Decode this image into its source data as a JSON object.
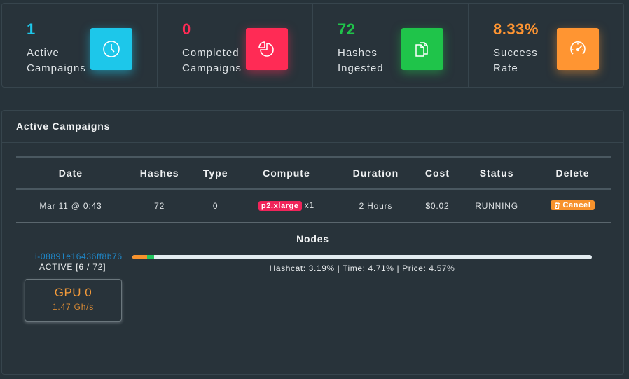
{
  "stats": [
    {
      "value": "1",
      "label": "Active Campaigns",
      "icon": "clock-icon",
      "color": "#1dc7ea",
      "glow": "rgba(29,199,234,0.55)"
    },
    {
      "value": "0",
      "label": "Completed Campaigns",
      "icon": "pie-chart-icon",
      "color": "#ff2b55",
      "glow": "rgba(255,43,85,0.5)"
    },
    {
      "value": "72",
      "label": "Hashes Ingested",
      "icon": "files-icon",
      "color": "#1fc44a",
      "glow": "rgba(31,196,74,0.5)"
    },
    {
      "value": "8.33%",
      "label": "Success Rate",
      "icon": "speedometer-icon",
      "color": "#ff9532",
      "glow": "rgba(255,149,50,0.5)"
    }
  ],
  "active_campaigns": {
    "title": "Active Campaigns",
    "columns": [
      "Date",
      "Hashes",
      "Type",
      "Compute",
      "Duration",
      "Cost",
      "Status",
      "Delete"
    ],
    "rows": [
      {
        "date": "Mar 11 @ 0:43",
        "hashes": "72",
        "type": "0",
        "compute_instance": "p2.xlarge",
        "compute_count": "x1",
        "duration": "2 Hours",
        "cost": "$0.02",
        "status": "RUNNING",
        "delete_label": "Cancel"
      }
    ]
  },
  "nodes": {
    "title": "Nodes",
    "items": [
      {
        "id": "i-08891e16436ff8b76",
        "status": "ACTIVE [6 / 72]",
        "progress": {
          "segments": [
            {
              "name": "price",
              "percent": 3.19,
              "color": "#f7922c"
            },
            {
              "name": "hashcat",
              "percent": 1.52,
              "color": "#22c55e"
            }
          ],
          "text": "Hashcat: 3.19% | Time: 4.71% | Price: 4.57%"
        },
        "gpus": [
          {
            "name": "GPU 0",
            "rate": "1.47 Gh/s"
          }
        ]
      }
    ]
  }
}
